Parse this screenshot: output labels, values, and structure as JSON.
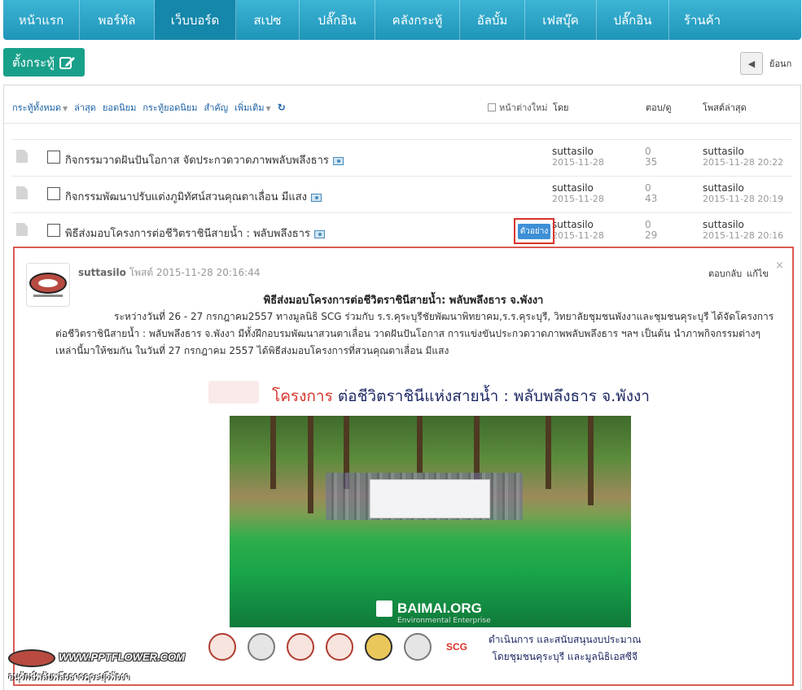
{
  "nav": {
    "items": [
      {
        "label": "หน้าแรก",
        "width": 94
      },
      {
        "label": "พอร์ทัล",
        "width": 92
      },
      {
        "label": "เว็บบอร์ด",
        "width": 100,
        "active": true
      },
      {
        "label": "สเปซ",
        "width": 78
      },
      {
        "label": "ปลั๊กอิน",
        "width": 93
      },
      {
        "label": "คลังกระทู้",
        "width": 104
      },
      {
        "label": "อัลบั้ม",
        "width": 80
      },
      {
        "label": "เฟสบุ๊ค",
        "width": 88
      },
      {
        "label": "ปลั๊กอิน",
        "width": 89
      },
      {
        "label": "ร้านค้า",
        "width": 81
      }
    ]
  },
  "toolbar": {
    "new_thread_label": "ตั้งกระทู้",
    "back_label": "ย้อนก"
  },
  "filters": {
    "all_threads": "กระทู้ทั้งหมด",
    "latest": "ล่าสุด",
    "popular": "ยอดนิยม",
    "hot_threads": "กระทู้ยอดนิยม",
    "important": "สำคัญ",
    "more": "เพิ่มเติม",
    "new_window": "หน้าต่างใหม่"
  },
  "columns": {
    "by": "โดย",
    "replies_views": "ตอบ/ดู",
    "last_post": "โพสต์ล่าสุด"
  },
  "threads": [
    {
      "title": "กิจกรรมวาดฝันปันโอกาส จัดประกวดวาดภาพพลับพลึงธาร",
      "author": "suttasilo",
      "date": "2015-11-28",
      "replies": "0",
      "views": "35",
      "last_author": "suttasilo",
      "last_time": "2015-11-28 20:22"
    },
    {
      "title": "กิจกรรมพัฒนาปรับแต่งภูมิทัศน์สวนคุณตาเลื่อน มีแสง",
      "author": "suttasilo",
      "date": "2015-11-28",
      "replies": "0",
      "views": "43",
      "last_author": "suttasilo",
      "last_time": "2015-11-28 20:19"
    },
    {
      "title": "พิธีส่งมอบโครงการต่อชีวิตราชินีสายน้ำ : พลับพลึงธาร",
      "author": "suttasilo",
      "date": "2015-11-28",
      "replies": "0",
      "views": "29",
      "last_author": "suttasilo",
      "last_time": "2015-11-28 20:16"
    }
  ],
  "badge": "ตัวอย่าง",
  "preview": {
    "author": "suttasilo",
    "posted_label": "โพสต์",
    "posted_time": "2015-11-28 20:16:44",
    "reply_label": "ตอบกลับ",
    "edit_label": "แก้ไข",
    "close_symbol": "×",
    "title": "พิธีส่งมอบโครงการต่อชีวิตราชินีสายน้ำ: พลับพลึงธาร จ.พังงา",
    "body": "ระหว่างวันที่ 26 - 27 กรกฎาคม2557 ทางมูลนิธิ SCG ร่วมกับ ร.ร.คุระบุรีชัยพัฒนาพิทยาคม,ร.ร.คุระบุรี, วิทยาลัยชุมชนพังงาและชุมชนคุระบุรี  ได้จัดโครงการต่อชีวิตราชินีสายน้ำ : พลับพลึงธาร จ.พังงา มีทั้งฝึกอบรมพัฒนาสวนตาเลื่อน วาดฝันปันโอกาส การแข่งขันประกวดวาดภาพพลับพลึงธาร ฯลฯ เป็นต้น  นำภาพกิจกรรมต่างๆเหล่านี้มาให้ชมกัน ในวันที่  27 กรกฎาคม 2557 ได้พิธีส่งมอบโครงการที่สวนคุณตาเลื่อน  มีแสง",
    "poster_head_red": "โครงการ",
    "poster_head_navy": "ต่อชีวิตราชินีแห่งสายน้ำ : พลับพลึงธาร จ.พังงา",
    "brand_name": "BAIMAI.ORG",
    "brand_sub": "Environmental Enterprise",
    "scg_label": "SCG",
    "support_line1": "ดำเนินการ และสนับสนุนงบประมาณ",
    "support_line2": "โดยชุมชนคุระบุรี และมูลนิธิเอสซีจี"
  },
  "watermark": {
    "url": "WWW.PPTFLOWER.COM",
    "sub": "อนุรักษ์พลับพลึงธารคุระบุรีพังงา"
  },
  "colors": {
    "nav": "#2aa5c9",
    "new_thread": "#19a08a",
    "highlight_border": "#d9342b",
    "link": "#1a60a3",
    "badge": "#3e8fd6"
  }
}
